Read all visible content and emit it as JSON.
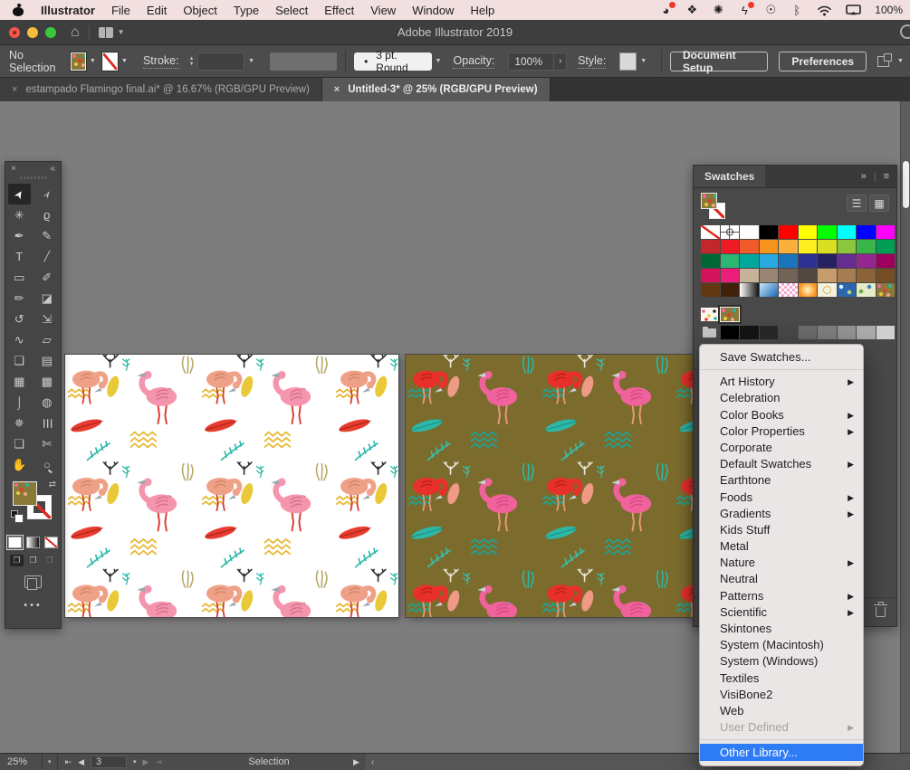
{
  "menubar": {
    "items": [
      "Illustrator",
      "File",
      "Edit",
      "Object",
      "Type",
      "Select",
      "Effect",
      "View",
      "Window",
      "Help"
    ],
    "battery": "100%",
    "status_icons": [
      {
        "name": "creative-cloud-icon",
        "glyph": "◕",
        "badge": true
      },
      {
        "name": "dropbox-icon",
        "glyph": "❖"
      },
      {
        "name": "settings-flower-icon",
        "glyph": "✺"
      },
      {
        "name": "sync-alert-icon",
        "glyph": "ϟ",
        "badge": true
      },
      {
        "name": "accessibility-icon",
        "glyph": "☉"
      },
      {
        "name": "bluetooth-icon",
        "glyph": "ᛒ"
      }
    ]
  },
  "titlebar": {
    "title": "Adobe Illustrator 2019"
  },
  "controlbar": {
    "no_selection": "No Selection",
    "stroke_label": "Stroke:",
    "brush_bullet": "•",
    "brush_label": "3 pt. Round",
    "opacity_label": "Opacity:",
    "opacity_value": "100%",
    "opacity_arrow": "›",
    "style_label": "Style:",
    "doc_setup_label": "Document Setup",
    "preferences_label": "Preferences"
  },
  "tabbar": {
    "close_glyph": "×",
    "tabs": [
      {
        "label": "estampado Flamingo final.ai* @ 16.67% (RGB/GPU Preview)",
        "active": false
      },
      {
        "label": "Untitled-3* @ 25% (RGB/GPU Preview)",
        "active": true
      }
    ]
  },
  "toolbar": {
    "close_glyph": "×",
    "collapse_glyph": "«",
    "ellipsis": "•••",
    "tools": [
      {
        "name": "selection",
        "glyph": "➤",
        "active": true
      },
      {
        "name": "direct-selection",
        "glyph": "➢"
      },
      {
        "name": "magic-wand",
        "glyph": "✳"
      },
      {
        "name": "lasso",
        "glyph": "ϱ"
      },
      {
        "name": "pen",
        "glyph": "✒"
      },
      {
        "name": "curvature",
        "glyph": "✎"
      },
      {
        "name": "type",
        "glyph": "T"
      },
      {
        "name": "line-segment",
        "glyph": "╱"
      },
      {
        "name": "rectangle",
        "glyph": "▭"
      },
      {
        "name": "paintbrush",
        "glyph": "✐"
      },
      {
        "name": "shaper",
        "glyph": "✏"
      },
      {
        "name": "eraser",
        "glyph": "◪"
      },
      {
        "name": "rotate",
        "glyph": "↺"
      },
      {
        "name": "scale",
        "glyph": "⇲"
      },
      {
        "name": "width",
        "glyph": "∿"
      },
      {
        "name": "free-transform",
        "glyph": "▱"
      },
      {
        "name": "shape-builder",
        "glyph": "❑"
      },
      {
        "name": "perspective-grid",
        "glyph": "▤"
      },
      {
        "name": "mesh",
        "glyph": "▦"
      },
      {
        "name": "gradient",
        "glyph": "▩"
      },
      {
        "name": "eyedropper",
        "glyph": "⌡"
      },
      {
        "name": "blend",
        "glyph": "◍"
      },
      {
        "name": "symbol-sprayer",
        "glyph": "✵"
      },
      {
        "name": "column-graph",
        "glyph": "☰"
      },
      {
        "name": "artboard",
        "glyph": "❏"
      },
      {
        "name": "slice",
        "glyph": "✄"
      },
      {
        "name": "hand",
        "glyph": "✋"
      },
      {
        "name": "zoom",
        "glyph": "○"
      }
    ]
  },
  "swatches": {
    "title": "Swatches",
    "collapse_glyph": "»",
    "menu_glyph": "≡",
    "list_view_glyph": "☰",
    "grid_view_glyph": "▦",
    "basic_rows": [
      [
        "none",
        "reg",
        "#ffffff",
        "#000000",
        "#ff0000",
        "#ffff00",
        "#00ff00",
        "#00ffff",
        "#0000ff",
        "#ff00ff"
      ],
      [
        "#c1272d",
        "#ed1c24",
        "#f15a29",
        "#f7941e",
        "#fbb03b",
        "#fcee21",
        "#d9e021",
        "#8cc63f",
        "#39b54a",
        "#009e54"
      ],
      [
        "#006837",
        "#2bb673",
        "#00a79d",
        "#29abe2",
        "#1c75bc",
        "#2e3192",
        "#262262",
        "#662d91",
        "#93278f",
        "#9e005d"
      ],
      [
        "#d4145a",
        "#ed1e79",
        "#c7b299",
        "#998675",
        "#736357",
        "#534741",
        "#c69c6d",
        "#a67c52",
        "#8c6239",
        "#754c24"
      ],
      [
        "#603913",
        "#42210b",
        "grad-bw",
        "grad-blue",
        "pat-pink",
        "grad-orange",
        "pat-lace",
        "pat-blue",
        "pat-green",
        "pat-flamingo"
      ]
    ],
    "pattern_row": [
      "pat-confetti",
      "pat-flamingo-selected"
    ],
    "gray_row": [
      "folder",
      "#000000",
      "#141414",
      "#282828",
      "#474747",
      "#6b6b6b",
      "#7d7d7d",
      "#939393",
      "#ababab",
      "#d0d0d0"
    ]
  },
  "context_menu": {
    "items": [
      {
        "label": "Save Swatches..."
      },
      {
        "type": "sep"
      },
      {
        "label": "Art History",
        "sub": true
      },
      {
        "label": "Celebration"
      },
      {
        "label": "Color Books",
        "sub": true
      },
      {
        "label": "Color Properties",
        "sub": true
      },
      {
        "label": "Corporate"
      },
      {
        "label": "Default Swatches",
        "sub": true
      },
      {
        "label": "Earthtone"
      },
      {
        "label": "Foods",
        "sub": true
      },
      {
        "label": "Gradients",
        "sub": true
      },
      {
        "label": "Kids Stuff"
      },
      {
        "label": "Metal"
      },
      {
        "label": "Nature",
        "sub": true
      },
      {
        "label": "Neutral"
      },
      {
        "label": "Patterns",
        "sub": true
      },
      {
        "label": "Scientific",
        "sub": true
      },
      {
        "label": "Skintones"
      },
      {
        "label": "System (Macintosh)"
      },
      {
        "label": "System (Windows)"
      },
      {
        "label": "Textiles"
      },
      {
        "label": "VisiBone2"
      },
      {
        "label": "Web"
      },
      {
        "label": "User Defined",
        "sub": true,
        "disabled": true
      },
      {
        "type": "sep"
      },
      {
        "label": "Other Library...",
        "highlighted": true
      }
    ]
  },
  "statusbar": {
    "zoom": "25%",
    "artboard_value": "3",
    "status": "Selection",
    "icons": {
      "first": "⇤",
      "prev": "◀",
      "next": "▶",
      "last": "⇥",
      "chev": "▾",
      "play": "▶",
      "scroll_left": "‹"
    }
  },
  "artboards": {
    "left": {
      "background": "#ffffff",
      "flamingo_a": "#f595ad",
      "flamingo_a_wing": "#d06b88",
      "flamingo_b": "#efa188",
      "flamingo_b_wing": "#c87a5e",
      "legs": "#d93a30",
      "feather": "#e73b2e",
      "feather_line": "#8a1a12",
      "feather2": "#e9c938",
      "waves": "#e5b832",
      "fern": "#2cb8a8",
      "coral": "#2d2d2d",
      "grass": "#b7aa67",
      "beak": "#97a6ad"
    },
    "right": {
      "background": "#7b6b2c",
      "flamingo_a": "#f0629b",
      "flamingo_a_wing": "#d14780",
      "flamingo_b": "#e8302a",
      "flamingo_b_wing": "#a81b17",
      "legs": "#e89a7a",
      "feather": "#2cb8a8",
      "feather_line": "#157d72",
      "feather2": "#ef9a84",
      "waves": "#1fa394",
      "fern": "#35bfae",
      "coral": "#e8e4da",
      "grass": "#2cb8a8",
      "beak": "#c9d4d8"
    }
  }
}
